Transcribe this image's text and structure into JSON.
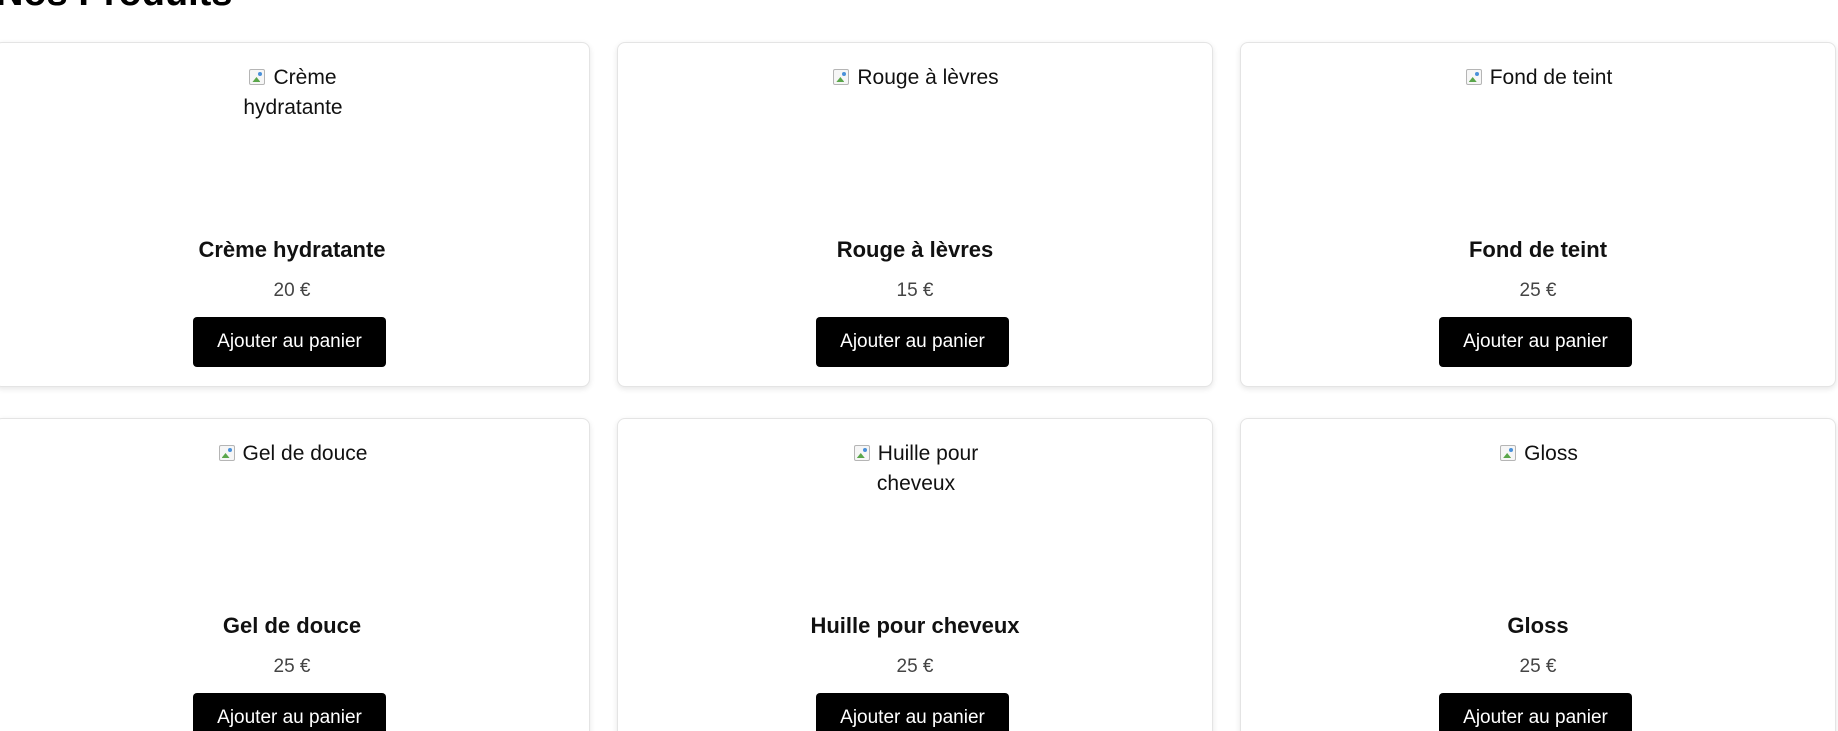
{
  "page": {
    "title": "Nos Produits"
  },
  "products": [
    {
      "image_alt": "Crème hydratante",
      "name": "Crème hydratante",
      "price": "20 €",
      "button_label": "Ajouter au panier"
    },
    {
      "image_alt": "Rouge à lèvres",
      "name": "Rouge à lèvres",
      "price": "15 €",
      "button_label": "Ajouter au panier"
    },
    {
      "image_alt": "Fond de teint",
      "name": "Fond de teint",
      "price": "25 €",
      "button_label": "Ajouter au panier"
    },
    {
      "image_alt": "Gel de douce",
      "name": "Gel de douce",
      "price": "25 €",
      "button_label": "Ajouter au panier"
    },
    {
      "image_alt": "Huille pour cheveux",
      "name": "Huille pour cheveux",
      "price": "25 €",
      "button_label": "Ajouter au panier"
    },
    {
      "image_alt": "Gloss",
      "name": "Gloss",
      "price": "25 €",
      "button_label": "Ajouter au panier"
    }
  ],
  "colors": {
    "button_background": "#000000",
    "button_text": "#ffffff",
    "price_text": "#444444",
    "card_border": "#e4e4e4"
  },
  "icons": {
    "product_image": "broken-image-icon"
  }
}
